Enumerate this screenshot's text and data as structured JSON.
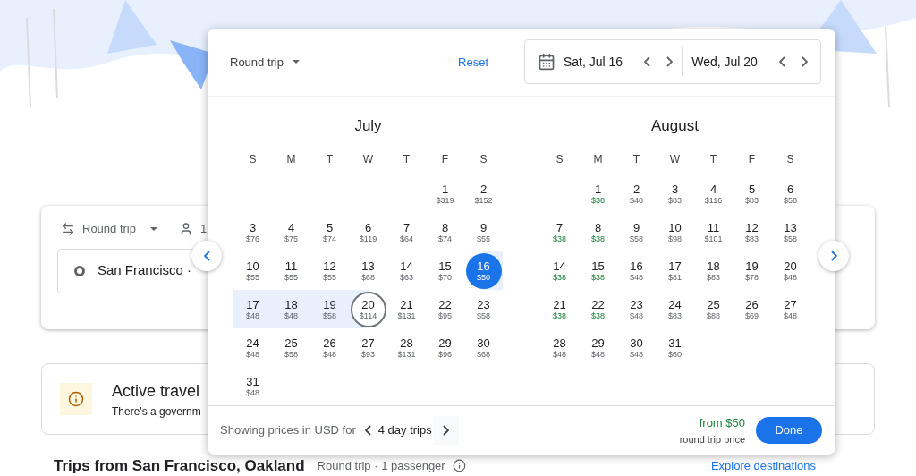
{
  "page": {
    "trip_type": "Round trip",
    "passengers": "1",
    "origin": "San Francisco ·",
    "alert": {
      "title": "Active travel",
      "text": "There's a governm"
    },
    "section": {
      "title": "Trips from San Francisco, Oakland",
      "meta": "Round trip · 1 passenger",
      "link": "Explore destinations"
    }
  },
  "dialog": {
    "trip_type": "Round trip",
    "reset": "Reset",
    "departure": "Sat, Jul 16",
    "return": "Wed, Jul 20",
    "months": [
      {
        "name": "July",
        "weekdays": [
          "S",
          "M",
          "T",
          "W",
          "T",
          "F",
          "S"
        ],
        "weeks": [
          [
            {
              "kind": "blank"
            },
            {
              "kind": "blank"
            },
            {
              "kind": "blank"
            },
            {
              "kind": "blank"
            },
            {
              "kind": "blank"
            },
            {
              "kind": "day",
              "day": "1",
              "price": "$319",
              "low": false
            },
            {
              "kind": "day",
              "day": "2",
              "price": "$152",
              "low": false
            }
          ],
          [
            {
              "kind": "day",
              "day": "3",
              "price": "$76",
              "low": false
            },
            {
              "kind": "day",
              "day": "4",
              "price": "$75",
              "low": false
            },
            {
              "kind": "day",
              "day": "5",
              "price": "$74",
              "low": false
            },
            {
              "kind": "day",
              "day": "6",
              "price": "$119",
              "low": false
            },
            {
              "kind": "day",
              "day": "7",
              "price": "$64",
              "low": false
            },
            {
              "kind": "day",
              "day": "8",
              "price": "$74",
              "low": false
            },
            {
              "kind": "day",
              "day": "9",
              "price": "$55",
              "low": false
            }
          ],
          [
            {
              "kind": "day",
              "day": "10",
              "price": "$55",
              "low": false
            },
            {
              "kind": "day",
              "day": "11",
              "price": "$55",
              "low": false
            },
            {
              "kind": "day",
              "day": "12",
              "price": "$55",
              "low": false
            },
            {
              "kind": "day",
              "day": "13",
              "price": "$68",
              "low": false
            },
            {
              "kind": "day",
              "day": "14",
              "price": "$63",
              "low": false
            },
            {
              "kind": "day",
              "day": "15",
              "price": "$70",
              "low": false
            },
            {
              "kind": "departure",
              "day": "16",
              "price": "$50",
              "low": false
            }
          ],
          [
            {
              "kind": "in_range",
              "day": "17",
              "price": "$48",
              "low": false
            },
            {
              "kind": "in_range",
              "day": "18",
              "price": "$48",
              "low": false
            },
            {
              "kind": "in_range",
              "day": "19",
              "price": "$58",
              "low": false
            },
            {
              "kind": "return",
              "day": "20",
              "price": "$114",
              "low": false
            },
            {
              "kind": "day",
              "day": "21",
              "price": "$131",
              "low": false
            },
            {
              "kind": "day",
              "day": "22",
              "price": "$95",
              "low": false
            },
            {
              "kind": "day",
              "day": "23",
              "price": "$58",
              "low": false
            }
          ],
          [
            {
              "kind": "day",
              "day": "24",
              "price": "$48",
              "low": false
            },
            {
              "kind": "day",
              "day": "25",
              "price": "$58",
              "low": false
            },
            {
              "kind": "day",
              "day": "26",
              "price": "$48",
              "low": false
            },
            {
              "kind": "day",
              "day": "27",
              "price": "$93",
              "low": false
            },
            {
              "kind": "day",
              "day": "28",
              "price": "$131",
              "low": false
            },
            {
              "kind": "day",
              "day": "29",
              "price": "$96",
              "low": false
            },
            {
              "kind": "day",
              "day": "30",
              "price": "$68",
              "low": false
            }
          ],
          [
            {
              "kind": "day",
              "day": "31",
              "price": "$48",
              "low": false
            }
          ]
        ]
      },
      {
        "name": "August",
        "weekdays": [
          "S",
          "M",
          "T",
          "W",
          "T",
          "F",
          "S"
        ],
        "weeks": [
          [
            {
              "kind": "blank"
            },
            {
              "kind": "day",
              "day": "1",
              "price": "$38",
              "low": true
            },
            {
              "kind": "day",
              "day": "2",
              "price": "$48",
              "low": false
            },
            {
              "kind": "day",
              "day": "3",
              "price": "$83",
              "low": false
            },
            {
              "kind": "day",
              "day": "4",
              "price": "$116",
              "low": false
            },
            {
              "kind": "day",
              "day": "5",
              "price": "$83",
              "low": false
            },
            {
              "kind": "day",
              "day": "6",
              "price": "$58",
              "low": false
            }
          ],
          [
            {
              "kind": "day",
              "day": "7",
              "price": "$38",
              "low": true
            },
            {
              "kind": "day",
              "day": "8",
              "price": "$38",
              "low": true
            },
            {
              "kind": "day",
              "day": "9",
              "price": "$58",
              "low": false
            },
            {
              "kind": "day",
              "day": "10",
              "price": "$98",
              "low": false
            },
            {
              "kind": "day",
              "day": "11",
              "price": "$101",
              "low": false
            },
            {
              "kind": "day",
              "day": "12",
              "price": "$83",
              "low": false
            },
            {
              "kind": "day",
              "day": "13",
              "price": "$58",
              "low": false
            }
          ],
          [
            {
              "kind": "day",
              "day": "14",
              "price": "$38",
              "low": true
            },
            {
              "kind": "day",
              "day": "15",
              "price": "$38",
              "low": true
            },
            {
              "kind": "day",
              "day": "16",
              "price": "$48",
              "low": false
            },
            {
              "kind": "day",
              "day": "17",
              "price": "$81",
              "low": false
            },
            {
              "kind": "day",
              "day": "18",
              "price": "$83",
              "low": false
            },
            {
              "kind": "day",
              "day": "19",
              "price": "$78",
              "low": false
            },
            {
              "kind": "day",
              "day": "20",
              "price": "$48",
              "low": false
            }
          ],
          [
            {
              "kind": "day",
              "day": "21",
              "price": "$38",
              "low": true
            },
            {
              "kind": "day",
              "day": "22",
              "price": "$38",
              "low": true
            },
            {
              "kind": "day",
              "day": "23",
              "price": "$48",
              "low": false
            },
            {
              "kind": "day",
              "day": "24",
              "price": "$83",
              "low": false
            },
            {
              "kind": "day",
              "day": "25",
              "price": "$88",
              "low": false
            },
            {
              "kind": "day",
              "day": "26",
              "price": "$69",
              "low": false
            },
            {
              "kind": "day",
              "day": "27",
              "price": "$48",
              "low": false
            }
          ],
          [
            {
              "kind": "day",
              "day": "28",
              "price": "$48",
              "low": false
            },
            {
              "kind": "day",
              "day": "29",
              "price": "$48",
              "low": false
            },
            {
              "kind": "day",
              "day": "30",
              "price": "$48",
              "low": false
            },
            {
              "kind": "day",
              "day": "31",
              "price": "$60",
              "low": false
            }
          ]
        ]
      }
    ],
    "footer": {
      "currency_note": "Showing prices in USD for",
      "duration": "4 day trips",
      "price": "from $50",
      "price_note": "round trip price",
      "done": "Done"
    }
  }
}
